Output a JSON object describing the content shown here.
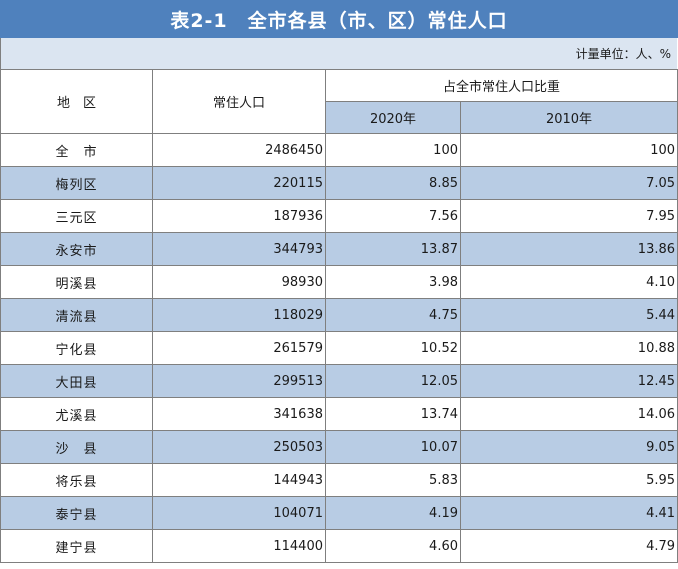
{
  "title": "表2-1　全市各县（市、区）常住人口",
  "unit": "计量单位：人、%",
  "headers": {
    "region": "地　区",
    "population": "常住人口",
    "share_group": "占全市常住人口比重",
    "year_2020": "2020年",
    "year_2010": "2010年"
  },
  "rows": [
    {
      "region": "全　市",
      "population": "2486450",
      "share_2020": "100",
      "share_2010": "100"
    },
    {
      "region": "梅列区",
      "population": "220115",
      "share_2020": "8.85",
      "share_2010": "7.05"
    },
    {
      "region": "三元区",
      "population": "187936",
      "share_2020": "7.56",
      "share_2010": "7.95"
    },
    {
      "region": "永安市",
      "population": "344793",
      "share_2020": "13.87",
      "share_2010": "13.86"
    },
    {
      "region": "明溪县",
      "population": "98930",
      "share_2020": "3.98",
      "share_2010": "4.10"
    },
    {
      "region": "清流县",
      "population": "118029",
      "share_2020": "4.75",
      "share_2010": "5.44"
    },
    {
      "region": "宁化县",
      "population": "261579",
      "share_2020": "10.52",
      "share_2010": "10.88"
    },
    {
      "region": "大田县",
      "population": "299513",
      "share_2020": "12.05",
      "share_2010": "12.45"
    },
    {
      "region": "尤溪县",
      "population": "341638",
      "share_2020": "13.74",
      "share_2010": "14.06"
    },
    {
      "region": "沙　县",
      "population": "250503",
      "share_2020": "10.07",
      "share_2010": "9.05"
    },
    {
      "region": "将乐县",
      "population": "144943",
      "share_2020": "5.83",
      "share_2010": "5.95"
    },
    {
      "region": "泰宁县",
      "population": "104071",
      "share_2020": "4.19",
      "share_2010": "4.41"
    },
    {
      "region": "建宁县",
      "population": "114400",
      "share_2020": "4.60",
      "share_2010": "4.79"
    }
  ],
  "colors": {
    "title_bg": "#4f81bd",
    "band_light": "#dbe5f1",
    "band_row": "#b8cce4",
    "border": "#7f7f7f"
  },
  "chart_data": {
    "type": "table",
    "title": "表2-1　全市各县（市、区）常住人口",
    "columns": [
      "地　区",
      "常住人口",
      "2020年",
      "2010年"
    ],
    "categories": [
      "全　市",
      "梅列区",
      "三元区",
      "永安市",
      "明溪县",
      "清流县",
      "宁化县",
      "大田县",
      "尤溪县",
      "沙　县",
      "将乐县",
      "泰宁县",
      "建宁县"
    ],
    "series": [
      {
        "name": "常住人口",
        "values": [
          2486450,
          220115,
          187936,
          344793,
          98930,
          118029,
          261579,
          299513,
          341638,
          250503,
          144943,
          104071,
          114400
        ]
      },
      {
        "name": "2020年",
        "values": [
          100,
          8.85,
          7.56,
          13.87,
          3.98,
          4.75,
          10.52,
          12.05,
          13.74,
          10.07,
          5.83,
          4.19,
          4.6
        ]
      },
      {
        "name": "2010年",
        "values": [
          100,
          7.05,
          7.95,
          13.86,
          4.1,
          5.44,
          10.88,
          12.45,
          14.06,
          9.05,
          5.95,
          4.41,
          4.79
        ]
      }
    ]
  }
}
